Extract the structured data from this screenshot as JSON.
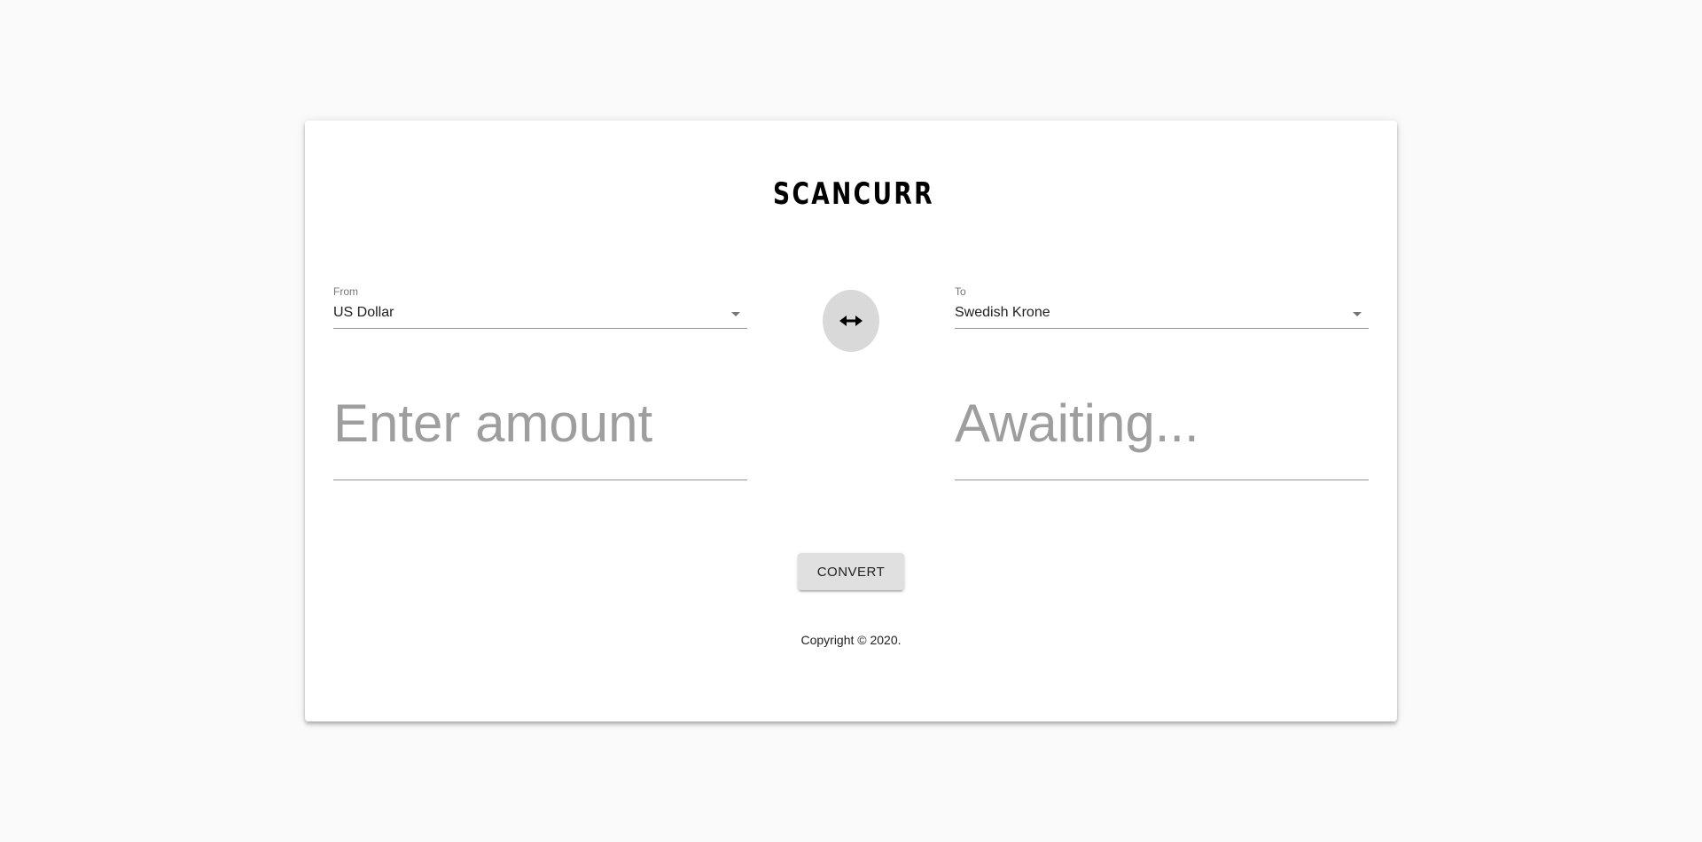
{
  "brand": {
    "logo_text": "SCANCURR",
    "logo_colors": {
      "chevron_back": "#8a8a8a",
      "chevron_front": "#000000",
      "text": "#000000"
    }
  },
  "converter": {
    "from": {
      "label": "From",
      "value": "US Dollar",
      "icon": "chevron-down-icon"
    },
    "to": {
      "label": "To",
      "value": "Swedish Krone",
      "icon": "chevron-down-icon"
    },
    "swap": {
      "icon": "swap-horizontal-icon",
      "color": "#d9d9d9"
    },
    "amount_input": {
      "placeholder": "Enter amount",
      "value": ""
    },
    "result_output": {
      "placeholder": "Awaiting...",
      "value": ""
    },
    "convert_label": "CONVERT"
  },
  "footer": {
    "copyright": "Copyright © 2020."
  },
  "colors": {
    "page_background": "#fafafa",
    "card_background": "#ffffff",
    "placeholder_text": "#9e9e9e",
    "button_background": "#e0e0e0"
  }
}
